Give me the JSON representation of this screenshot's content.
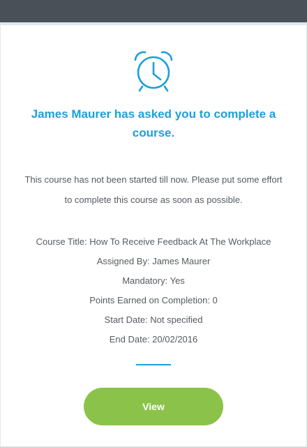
{
  "email": {
    "headline": "James Maurer has asked you to complete a course.",
    "intro": "This course has not been started till now. Please put some effort to complete this course as soon as possible.",
    "details": {
      "course_title": "Course Title: How To Receive Feedback At The Workplace",
      "assigned_by": "Assigned By: James Maurer",
      "mandatory": "Mandatory: Yes",
      "points": "Points Earned on Completion: 0",
      "start_date": "Start Date: Not specified",
      "end_date": "End Date: 20/02/2016"
    },
    "view_label": "View"
  },
  "icons": {
    "header": "alarm-clock-icon"
  },
  "colors": {
    "accent": "#1aa0dd",
    "button": "#8bc34a",
    "top_bar": "#4a5057",
    "text": "#555b61"
  }
}
